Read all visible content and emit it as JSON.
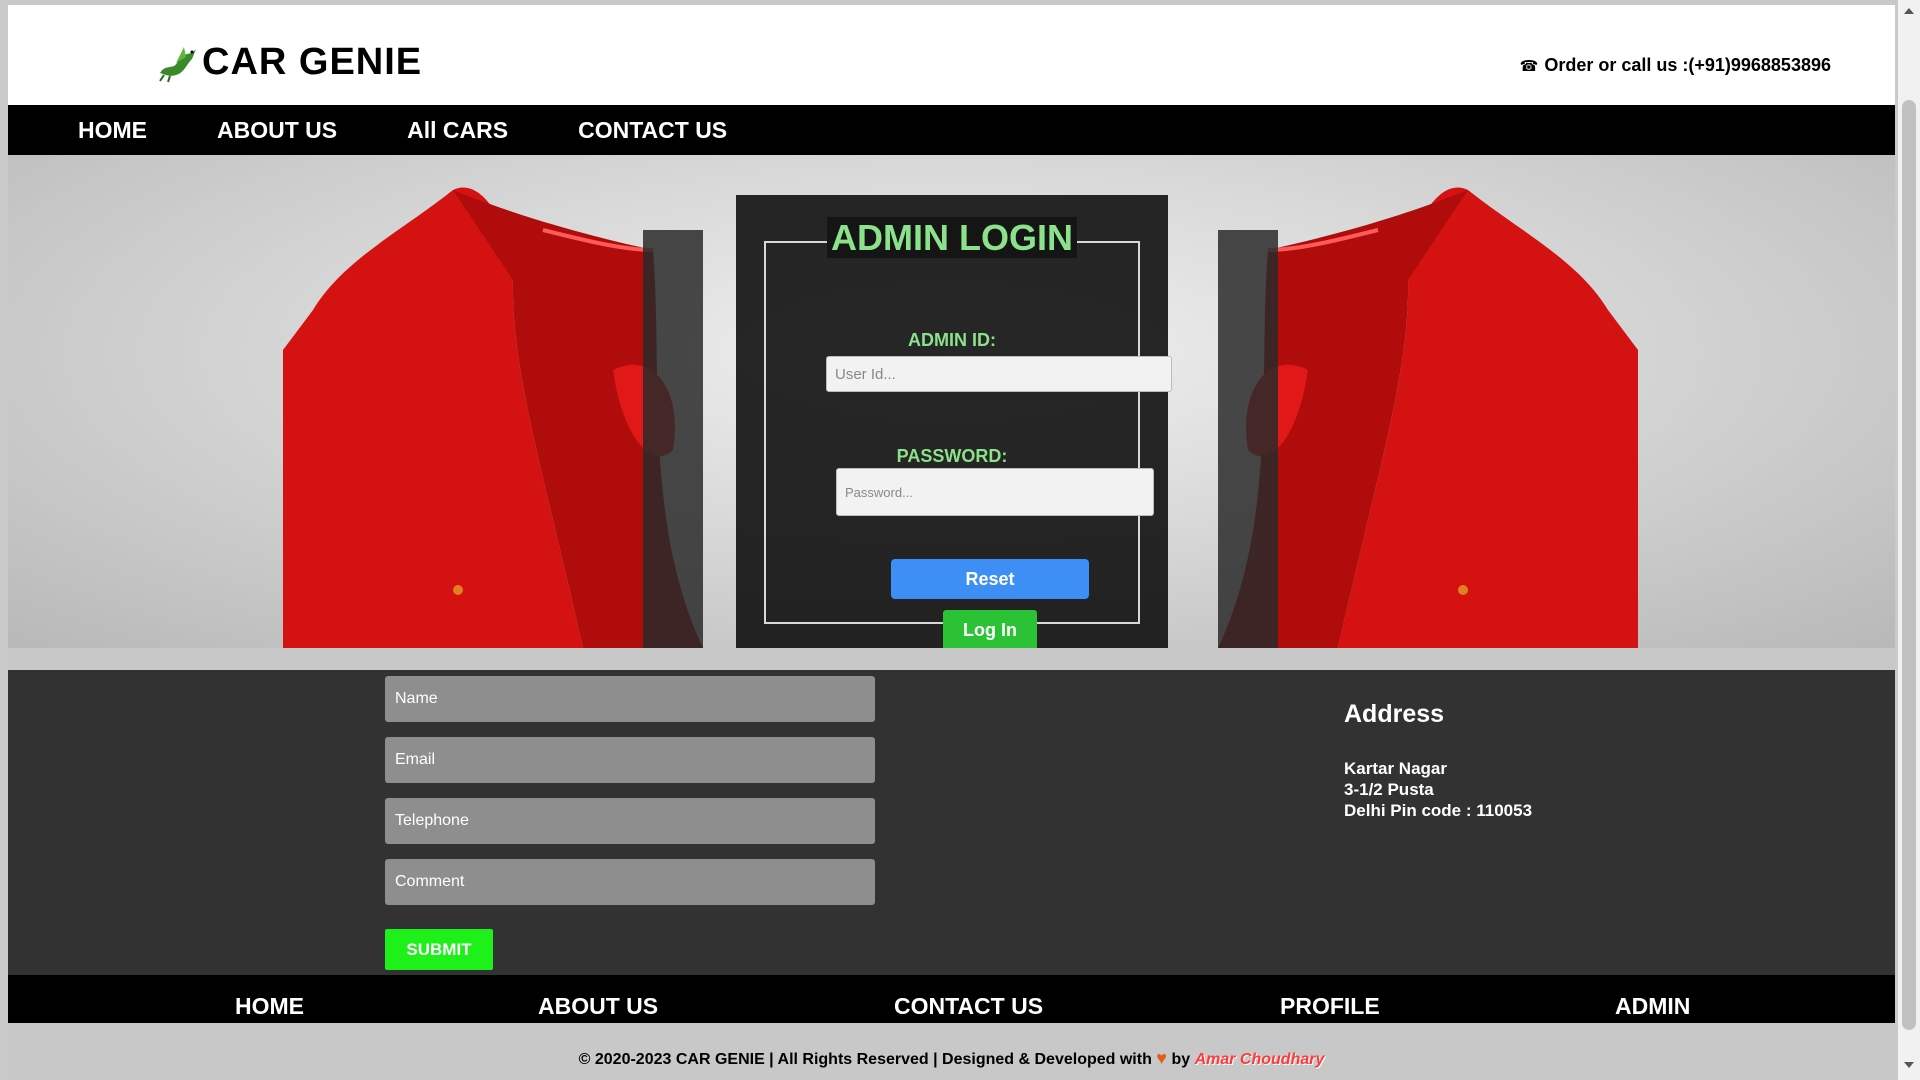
{
  "header": {
    "logo_text": "CAR GENIE",
    "logo_icon": "dragon-icon",
    "call_text": "Order or call us :(+91)9968853896",
    "phone_icon": "phone-icon"
  },
  "nav": {
    "items": [
      "HOME",
      "ABOUT US",
      "All CARS",
      "CONTACT US"
    ]
  },
  "login": {
    "title": "ADMIN LOGIN",
    "id_label": "ADMIN ID:",
    "id_placeholder": "User Id...",
    "pw_label": "PASSWORD:",
    "pw_placeholder": "Password...",
    "reset_label": "Reset",
    "login_label": "Log In"
  },
  "contact_form": {
    "name_placeholder": "Name",
    "email_placeholder": "Email",
    "telephone_placeholder": "Telephone",
    "comment_placeholder": "Comment",
    "submit_label": "SUBMIT"
  },
  "address": {
    "title": "Address",
    "line1": "Kartar Nagar",
    "line2": "3-1/2 Pusta",
    "line3": "Delhi Pin code : 110053"
  },
  "footer_nav": {
    "items": [
      "HOME",
      "ABOUT US",
      "CONTACT US",
      "PROFILE",
      "ADMIN"
    ]
  },
  "footer": {
    "copyright_prefix": "© 2020-2023 CAR GENIE | All Rights Reserved | Designed & Developed with",
    "heart_icon": "heart-icon",
    "by": "by",
    "author": "Amar Choudhary"
  },
  "colors": {
    "accent_green": "#8be28b",
    "reset_blue": "#3d8ef5",
    "login_green": "#2bc236",
    "submit_green": "#1ef01a",
    "car_red": "#e01414"
  }
}
